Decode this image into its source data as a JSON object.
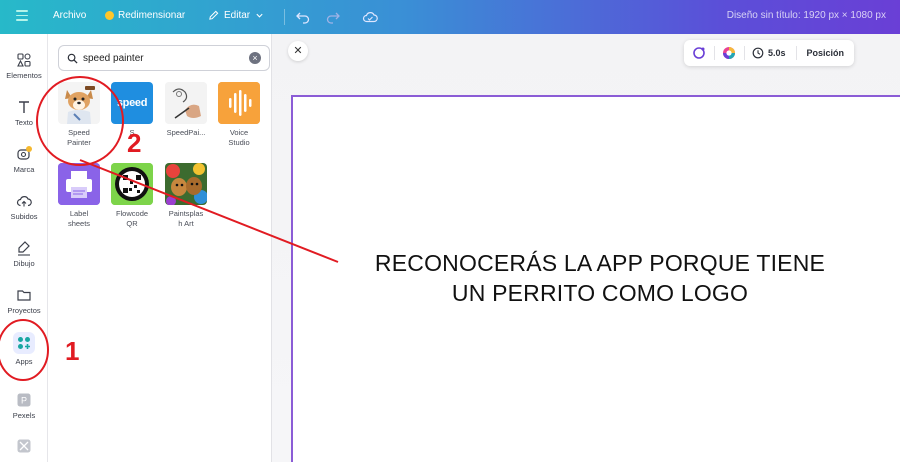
{
  "topbar": {
    "archivo": "Archivo",
    "redimensionar": "Redimensionar",
    "editar": "Editar",
    "design_title": "Diseño sin título: 1920 px × 1080 px"
  },
  "rail": {
    "items": [
      {
        "label": "Elementos",
        "icon": "shapes-icon"
      },
      {
        "label": "Texto",
        "icon": "text-icon"
      },
      {
        "label": "Marca",
        "icon": "brand-icon"
      },
      {
        "label": "Subidos",
        "icon": "upload-cloud-icon"
      },
      {
        "label": "Dibujo",
        "icon": "draw-icon"
      },
      {
        "label": "Proyectos",
        "icon": "folder-icon"
      },
      {
        "label": "Apps",
        "icon": "apps-icon"
      },
      {
        "label": "Pexels",
        "icon": "pexels-icon"
      }
    ]
  },
  "search": {
    "value": "speed painter"
  },
  "apps": [
    {
      "label": "Speed Painter",
      "label_l1": "Speed",
      "label_l2": "Painter",
      "icon": "dog-painter-icon"
    },
    {
      "label": "Speed",
      "label_l1": "S",
      "label_l2": "",
      "logo_text": "speed",
      "icon": "speed-logo-icon"
    },
    {
      "label": "SpeedPai...",
      "label_l1": "SpeedPai...",
      "label_l2": "",
      "icon": "sketch-hand-icon"
    },
    {
      "label": "Voice Studio",
      "label_l1": "Voice",
      "label_l2": "Studio",
      "icon": "voice-wave-icon"
    },
    {
      "label": "Label sheets",
      "label_l1": "Label",
      "label_l2": "sheets",
      "icon": "printer-icon"
    },
    {
      "label": "Flowcode QR",
      "label_l1": "Flowcode",
      "label_l2": "QR",
      "icon": "qr-code-icon"
    },
    {
      "label": "Paintsplash Art",
      "label_l1": "Paintsplas",
      "label_l2": "h Art",
      "icon": "paint-dogs-icon"
    }
  ],
  "toolbar": {
    "duration": "5.0s",
    "posicion": "Posición"
  },
  "annotation": {
    "line1": "RECONOCERÁS LA APP PORQUE TIENE",
    "line2": "UN PERRITO COMO LOGO",
    "step1": "1",
    "step2": "2"
  },
  "colors": {
    "annotation_red": "#e11b22",
    "page_border": "#8b5cd6",
    "brand_gradient_start": "#27b9c9",
    "brand_gradient_end": "#6a3fd6"
  }
}
